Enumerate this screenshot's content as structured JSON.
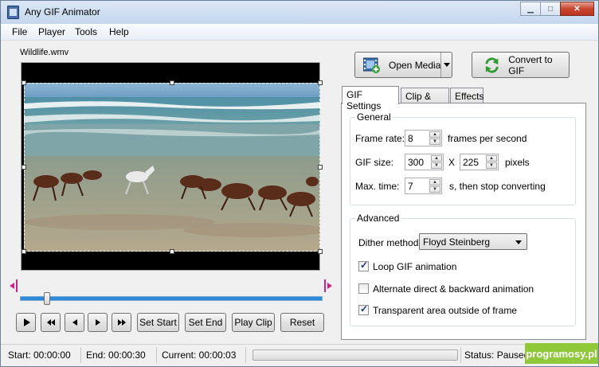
{
  "window": {
    "title": "Any GIF Animator"
  },
  "menu": [
    "File",
    "Player",
    "Tools",
    "Help"
  ],
  "video": {
    "filename": "Wildlife.wmv"
  },
  "player": {
    "set_start": "Set Start",
    "set_end": "Set End",
    "play_clip": "Play Clip",
    "reset": "Reset",
    "position_fraction": 0.09
  },
  "toolbar": {
    "open_media": "Open Media",
    "convert": "Convert to GIF"
  },
  "tabs": [
    "GIF Settings",
    "Clip & Crop",
    "Effects"
  ],
  "general": {
    "title": "General",
    "frame_rate_label": "Frame rate:",
    "frame_rate": "8",
    "frame_rate_unit": "frames per second",
    "gif_size_label": "GIF size:",
    "width": "300",
    "size_x": "X",
    "height": "225",
    "size_unit": "pixels",
    "max_time_label": "Max. time:",
    "max_time": "7",
    "max_time_unit": "s, then stop converting"
  },
  "advanced": {
    "title": "Advanced",
    "dither_label": "Dither method:",
    "dither_value": "Floyd Steinberg",
    "loop_label": "Loop GIF animation",
    "loop_checked": true,
    "alternate_label": "Alternate direct & backward animation",
    "alternate_checked": false,
    "transparent_label": "Transparent area outside of frame",
    "transparent_checked": true
  },
  "status": {
    "start": "Start: 00:00:00",
    "end": "End: 00:00:30",
    "current": "Current: 00:00:03",
    "state": "Status: Paused"
  },
  "watermark": "programosy.pl",
  "colors": {
    "accent_blue": "#2e8ad8",
    "close_red": "#c9452f",
    "watermark_green": "#8fc93a"
  }
}
